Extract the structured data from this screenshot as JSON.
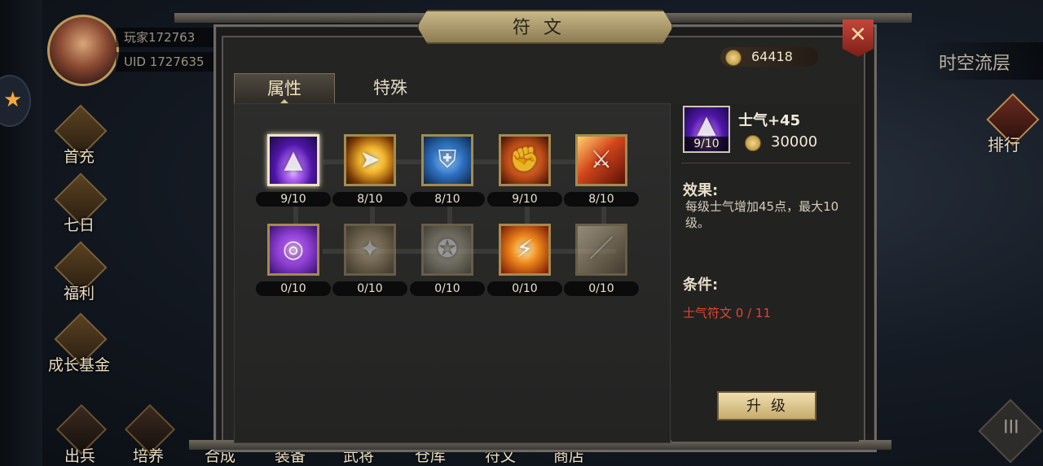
{
  "background": {
    "player": {
      "name": "玩家172763",
      "uid": "UID 1727635"
    },
    "side_menu": [
      {
        "label": "首充",
        "icon": "gold-coins-icon"
      },
      {
        "label": "七日",
        "icon": "scroll-icon"
      },
      {
        "label": "福利",
        "icon": "treasure-chest-icon"
      },
      {
        "label": "成长基金",
        "icon": "gold-pile-icon"
      }
    ],
    "bottom_nav": [
      "出兵",
      "培养",
      "合成",
      "装备",
      "武将",
      "仓库",
      "符文",
      "商店"
    ],
    "right_mode_label": "时空流层",
    "rank_label": "排行",
    "menu_glyph": "III"
  },
  "dialog": {
    "title": "符文",
    "close_icon": "close-icon",
    "currency": {
      "amount": "64418",
      "icon": "coin-icon"
    },
    "tabs": [
      {
        "label": "属性",
        "active": true
      },
      {
        "label": "特殊",
        "active": false
      }
    ],
    "runes": [
      {
        "icon": "purple-beam-icon",
        "count": "9/10",
        "selected": true
      },
      {
        "icon": "dash-icon",
        "count": "8/10"
      },
      {
        "icon": "shield-icon",
        "count": "8/10"
      },
      {
        "icon": "muscle-icon",
        "count": "9/10"
      },
      {
        "icon": "flaming-sword-icon",
        "count": "8/10"
      },
      {
        "icon": "purple-vortex-icon",
        "count": "0/10"
      },
      {
        "icon": "flying-kick-icon",
        "count": "0/10",
        "locked": true
      },
      {
        "icon": "aura-icon",
        "count": "0/10",
        "locked": true
      },
      {
        "icon": "lightning-icon",
        "count": "0/10"
      },
      {
        "icon": "blade-icon",
        "count": "0/10",
        "locked": true
      }
    ],
    "detail": {
      "icon_level": "9/10",
      "name": "士气+45",
      "cost": "30000",
      "effect_title": "效果:",
      "effect_text": "每级士气增加45点，最大10级。",
      "condition_title": "条件:",
      "condition_text": "士气符文  0 / 11",
      "upgrade_label": "升级"
    }
  }
}
